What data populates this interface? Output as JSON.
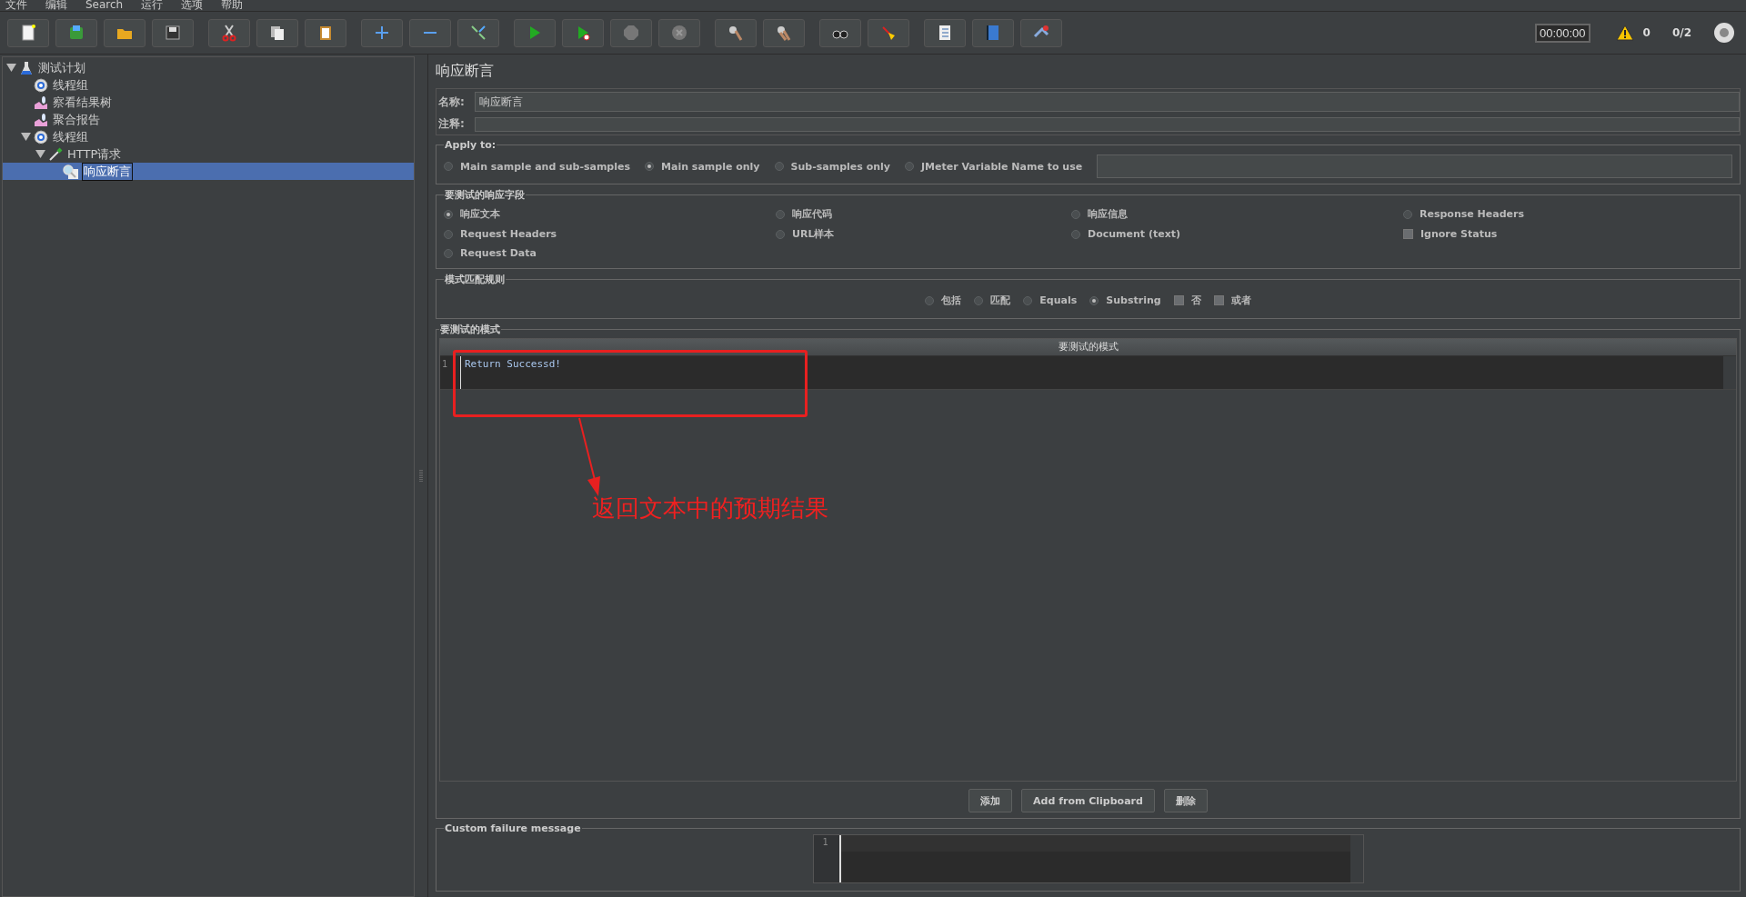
{
  "menu": [
    {
      "label": "文件"
    },
    {
      "label": "编辑"
    },
    {
      "label": "Search"
    },
    {
      "label": "运行"
    },
    {
      "label": "选项"
    },
    {
      "label": "帮助"
    }
  ],
  "status": {
    "timer": "00:00:00",
    "warnings": "0",
    "threads": "0/2"
  },
  "tree": [
    {
      "label": "测试计划",
      "kind": "plan",
      "expanded": true,
      "selected": false,
      "children": [
        {
          "label": "线程组",
          "kind": "thread-group",
          "selected": false
        },
        {
          "label": "察看结果树",
          "kind": "listener",
          "selected": false
        },
        {
          "label": "聚合报告",
          "kind": "listener",
          "selected": false
        },
        {
          "label": "线程组",
          "kind": "thread-group",
          "expanded": true,
          "selected": false,
          "children": [
            {
              "label": "HTTP请求",
              "kind": "sampler",
              "expanded": true,
              "selected": false,
              "children": [
                {
                  "label": "响应断言",
                  "kind": "assertion",
                  "selected": true
                }
              ]
            }
          ]
        }
      ]
    }
  ],
  "form": {
    "title": "响应断言",
    "name_label": "名称:",
    "name_value": "响应断言",
    "comment_label": "注释:"
  },
  "apply_to": {
    "legend": "Apply to:",
    "options": [
      {
        "label": "Main sample and sub-samples",
        "selected": false
      },
      {
        "label": "Main sample only",
        "selected": true
      },
      {
        "label": "Sub-samples only",
        "selected": false
      },
      {
        "label": "JMeter Variable Name to use",
        "selected": false
      }
    ]
  },
  "fields": {
    "legend": "要测试的响应字段",
    "options": [
      {
        "label": "响应文本",
        "kind": "radio",
        "selected": true
      },
      {
        "label": "响应代码",
        "kind": "radio",
        "selected": false
      },
      {
        "label": "响应信息",
        "kind": "radio",
        "selected": false
      },
      {
        "label": "Response Headers",
        "kind": "radio",
        "selected": false
      },
      {
        "label": "Request Headers",
        "kind": "radio",
        "selected": false
      },
      {
        "label": "URL样本",
        "kind": "radio",
        "selected": false
      },
      {
        "label": "Document (text)",
        "kind": "radio",
        "selected": false
      },
      {
        "label": "Ignore Status",
        "kind": "checkbox",
        "checked": false
      },
      {
        "label": "Request Data",
        "kind": "radio",
        "selected": false
      }
    ]
  },
  "match_rules": {
    "legend": "模式匹配规则",
    "options": [
      {
        "label": "包括",
        "kind": "radio",
        "selected": false
      },
      {
        "label": "匹配",
        "kind": "radio",
        "selected": false
      },
      {
        "label": "Equals",
        "kind": "radio",
        "selected": false
      },
      {
        "label": "Substring",
        "kind": "radio",
        "selected": true
      },
      {
        "label": "否",
        "kind": "checkbox",
        "checked": false
      },
      {
        "label": "或者",
        "kind": "checkbox",
        "checked": false
      }
    ]
  },
  "patterns": {
    "legend": "要测试的模式",
    "column": "要测试的模式",
    "rows": [
      {
        "line": "1",
        "text": "Return Successd!"
      }
    ],
    "buttons": [
      {
        "label": "添加"
      },
      {
        "label": "Add from Clipboard"
      },
      {
        "label": "删除"
      }
    ]
  },
  "failure": {
    "legend": "Custom failure message",
    "lines": [
      "1"
    ]
  },
  "annotation": {
    "text": "返回文本中的预期结果"
  }
}
